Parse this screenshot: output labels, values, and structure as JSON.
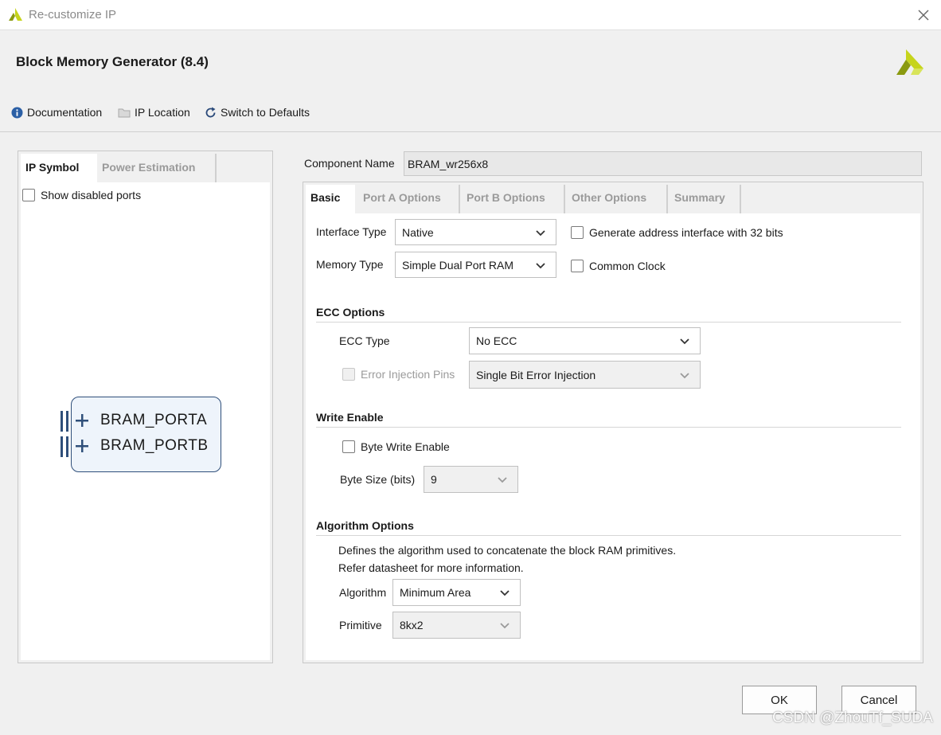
{
  "window": {
    "title": "Re-customize IP",
    "close_icon": "close-icon"
  },
  "header": {
    "title": "Block Memory Generator (8.4)",
    "logo_icon": "xilinx-logo-icon"
  },
  "toolbar": {
    "documentation": "Documentation",
    "ip_location": "IP Location",
    "switch_defaults": "Switch to Defaults"
  },
  "left_panel": {
    "tabs": [
      "IP Symbol",
      "Power Estimation"
    ],
    "show_disabled_ports": "Show disabled ports",
    "ports": [
      "BRAM_PORTA",
      "BRAM_PORTB"
    ]
  },
  "component": {
    "label": "Component Name",
    "value": "BRAM_wr256x8"
  },
  "tabs": [
    "Basic",
    "Port A Options",
    "Port B Options",
    "Other Options",
    "Summary"
  ],
  "basic": {
    "interface_type_label": "Interface Type",
    "interface_type_value": "Native",
    "memory_type_label": "Memory Type",
    "memory_type_value": "Simple Dual Port RAM",
    "gen_addr_32": "Generate address interface with 32 bits",
    "common_clock": "Common Clock",
    "ecc_section": "ECC Options",
    "ecc_type_label": "ECC Type",
    "ecc_type_value": "No ECC",
    "error_injection_label": "Error Injection Pins",
    "error_injection_value": "Single Bit Error Injection",
    "write_enable_section": "Write Enable",
    "byte_write_enable": "Byte Write Enable",
    "byte_size_label": "Byte Size (bits)",
    "byte_size_value": "9",
    "algorithm_section": "Algorithm Options",
    "algo_desc_1": "Defines the algorithm used to concatenate the block RAM primitives.",
    "algo_desc_2": "Refer datasheet for more information.",
    "algorithm_label": "Algorithm",
    "algorithm_value": "Minimum Area",
    "primitive_label": "Primitive",
    "primitive_value": "8kx2"
  },
  "footer": {
    "ok": "OK",
    "cancel": "Cancel"
  },
  "watermark": "CSDN @ZhouTf_SUDA",
  "colors": {
    "accent_yellow": "#c6d41c",
    "port_blue": "#2f4f7a",
    "symbol_fill": "#eef4fb"
  }
}
